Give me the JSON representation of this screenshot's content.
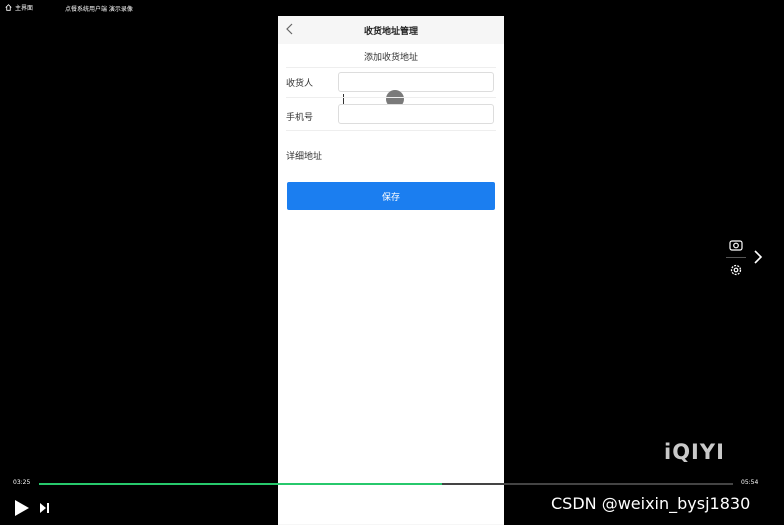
{
  "player": {
    "home_label": "主界面",
    "video_title": "点餐系统用户端 演示录像",
    "current_time": "03:25",
    "total_time": "05:54",
    "progress_percent": 58,
    "watermark": "iQIYI",
    "overlay_text": "CSDN @weixin_bysj1830",
    "progress_color": "#27c86c"
  },
  "app": {
    "nav_title": "收货地址管理",
    "form_title": "添加收货地址",
    "fields": [
      {
        "label": "收货人",
        "value": ""
      },
      {
        "label": "手机号",
        "value": ""
      },
      {
        "label": "详细地址",
        "value": ""
      }
    ],
    "save_label": "保存",
    "accent": "#1b7ef0"
  }
}
